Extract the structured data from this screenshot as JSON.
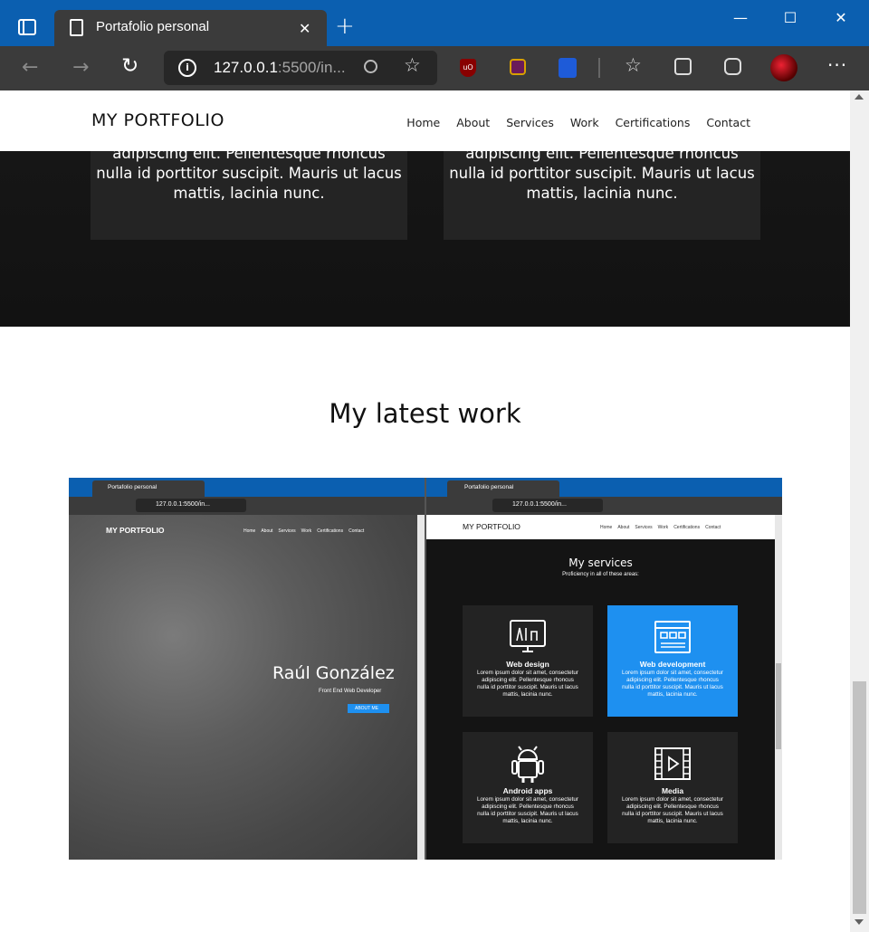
{
  "browser": {
    "tab_title": "Portafolio personal",
    "url_host": "127.0.0.1",
    "url_rest": ":5500/in...",
    "window_controls": {
      "minimize": "—",
      "maximize": "☐",
      "close": "✕"
    }
  },
  "site": {
    "brand": "MY PORTFOLIO",
    "nav": [
      "Home",
      "About",
      "Services",
      "Work",
      "Certifications",
      "Contact"
    ]
  },
  "services_cards": [
    {
      "text_lines": [
        "adipiscing elit. Pellentesque rhoncus",
        "nulla id porttitor suscipit. Mauris ut lacus",
        "mattis, lacinia nunc."
      ]
    },
    {
      "text_lines": [
        "adipiscing elit. Pellentesque rhoncus",
        "nulla id porttitor suscipit. Mauris ut lacus",
        "mattis, lacinia nunc."
      ]
    }
  ],
  "work": {
    "heading": "My latest work"
  },
  "preview": {
    "tab_title": "Portafolio personal",
    "url": "127.0.0.1:5500/in...",
    "brand": "MY PORTFOLIO",
    "nav": [
      "Home",
      "About",
      "Services",
      "Work",
      "Certifications",
      "Contact"
    ],
    "hero_name": "Raúl González",
    "hero_sub": "Front End Web Developer",
    "hero_button": "ABOUT ME",
    "services_title": "My services",
    "services_sub": "Proficiency in all of these areas:",
    "cards": [
      {
        "title": "Web design",
        "text": [
          "Lorem ipsum dolor sit amet, consectetur",
          "adipiscing elit. Pellentesque rhoncus",
          "nulla id porttitor suscipit. Mauris ut lacus",
          "mattis, lacinia nunc."
        ]
      },
      {
        "title": "Web development",
        "text": [
          "Lorem ipsum dolor sit amet, consectetur",
          "adipiscing elit. Pellentesque rhoncus",
          "nulla id porttitor suscipit. Mauris ut lacus",
          "mattis, lacinia nunc."
        ]
      },
      {
        "title": "Android apps",
        "text": [
          "Lorem ipsum dolor sit amet, consectetur",
          "adipiscing elit. Pellentesque rhoncus",
          "nulla id porttitor suscipit. Mauris ut lacus",
          "mattis, lacinia nunc."
        ]
      },
      {
        "title": "Media",
        "text": [
          "Lorem ipsum dolor sit amet, consectetur",
          "adipiscing elit. Pellentesque rhoncus",
          "nulla id porttitor suscipit. Mauris ut lacus",
          "mattis, lacinia nunc."
        ]
      }
    ]
  },
  "colors": {
    "titlebar": "#0b5fb0",
    "toolbar": "#3b3b3b",
    "accent": "#1e90f0",
    "dark_section": "#141414",
    "card": "#242424"
  }
}
